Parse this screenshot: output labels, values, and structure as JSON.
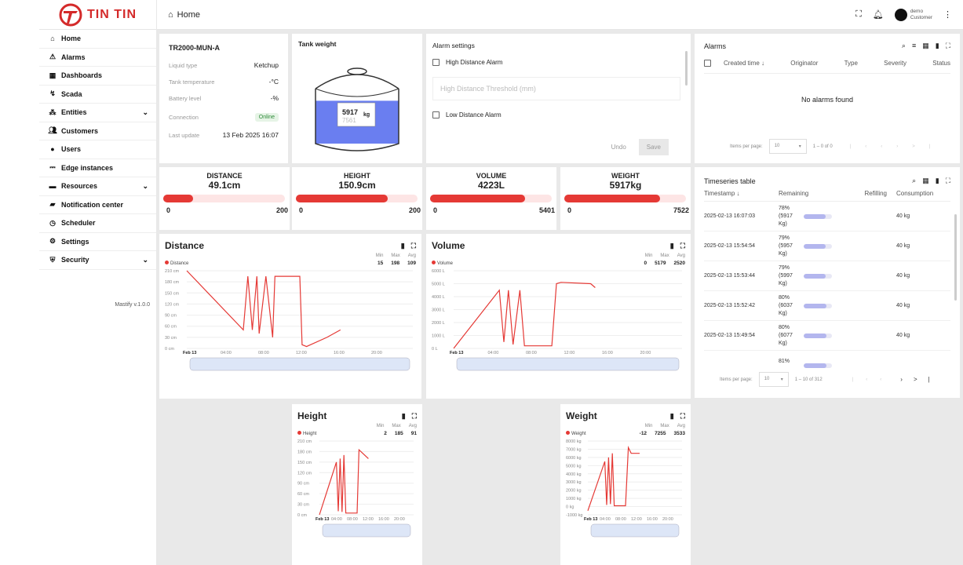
{
  "brand": {
    "name": "TIN TIN"
  },
  "nav": [
    {
      "label": "Home",
      "icon": "home-icon",
      "chev": ""
    },
    {
      "label": "Alarms",
      "icon": "warning-icon",
      "chev": ""
    },
    {
      "label": "Dashboards",
      "icon": "dashboard-icon",
      "chev": ""
    },
    {
      "label": "Scada",
      "icon": "scada-icon",
      "chev": ""
    },
    {
      "label": "Entities",
      "icon": "entities-icon",
      "chev": "⌄"
    },
    {
      "label": "Customers",
      "icon": "customers-icon",
      "chev": ""
    },
    {
      "label": "Users",
      "icon": "user-icon",
      "chev": ""
    },
    {
      "label": "Edge instances",
      "icon": "edge-icon",
      "chev": ""
    },
    {
      "label": "Resources",
      "icon": "folder-icon",
      "chev": "⌄"
    },
    {
      "label": "Notification center",
      "icon": "inbox-icon",
      "chev": ""
    },
    {
      "label": "Scheduler",
      "icon": "clock-icon",
      "chev": ""
    },
    {
      "label": "Settings",
      "icon": "gear-icon",
      "chev": ""
    },
    {
      "label": "Security",
      "icon": "shield-icon",
      "chev": "⌄"
    }
  ],
  "version": "Mastify v.1.0.0",
  "topbar": {
    "title": "Home",
    "user_name": "demo",
    "user_role": "Customer"
  },
  "device": {
    "name": "TR2000-MUN-A",
    "rows": [
      {
        "label": "Liquid type",
        "value": "Ketchup"
      },
      {
        "label": "Tank temperature",
        "value": "-°C"
      },
      {
        "label": "Battery level",
        "value": "-%"
      }
    ],
    "connection_label": "Connection",
    "connection_value": "Online",
    "update_label": "Last update",
    "update_value": "13 Feb 2025 16:07"
  },
  "tank": {
    "title": "Tank weight",
    "value": "5917",
    "capacity": "7561",
    "unit": "kg",
    "fill": 0.78
  },
  "alarm_settings": {
    "title": "Alarm settings",
    "high_label": "High Distance Alarm",
    "threshold_placeholder": "High Distance Threshold (mm)",
    "low_label": "Low Distance Alarm",
    "undo": "Undo",
    "save": "Save"
  },
  "alarms": {
    "title": "Alarms",
    "cols": [
      "Created time ↓",
      "Originator",
      "Type",
      "Severity",
      "Status"
    ],
    "empty": "No alarms found",
    "ipp_label": "Items per page:",
    "ipp": "10",
    "range": "1 – 0 of 0"
  },
  "gauges": [
    {
      "title": "DISTANCE",
      "value": "49.1cm",
      "min": "0",
      "max": "200",
      "fill": 0.245
    },
    {
      "title": "HEIGHT",
      "value": "150.9cm",
      "min": "0",
      "max": "200",
      "fill": 0.755
    },
    {
      "title": "VOLUME",
      "value": "4223L",
      "min": "0",
      "max": "5401",
      "fill": 0.782
    },
    {
      "title": "WEIGHT",
      "value": "5917kg",
      "min": "0",
      "max": "7522",
      "fill": 0.787
    }
  ],
  "stat_labels": {
    "min": "Min",
    "max": "Max",
    "avg": "Avg"
  },
  "charts": {
    "distance": {
      "title": "Distance",
      "legend": "Distance",
      "min": "15",
      "max": "198",
      "avg": "109",
      "yticks": [
        "210 cm",
        "180 cm",
        "150 cm",
        "120 cm",
        "90 cm",
        "60 cm",
        "30 cm",
        "0 cm"
      ],
      "xticks": [
        "Feb 13",
        "04:00",
        "08:00",
        "12:00",
        "16:00",
        "20:00"
      ]
    },
    "volume": {
      "title": "Volume",
      "legend": "Volume",
      "min": "0",
      "max": "5179",
      "avg": "2520",
      "yticks": [
        "6000 L",
        "5000 L",
        "4000 L",
        "3000 L",
        "2000 L",
        "1000 L",
        "0 L"
      ],
      "xticks": [
        "Feb 13",
        "04:00",
        "08:00",
        "12:00",
        "16:00",
        "20:00"
      ]
    },
    "height": {
      "title": "Height",
      "legend": "Height",
      "min": "2",
      "max": "185",
      "avg": "91",
      "yticks": [
        "210 cm",
        "180 cm",
        "150 cm",
        "120 cm",
        "90 cm",
        "60 cm",
        "30 cm",
        "0 cm"
      ],
      "xticks": [
        "Feb 13",
        "04:00",
        "08:00",
        "12:00",
        "16:00",
        "20:00"
      ]
    },
    "weight": {
      "title": "Weight",
      "legend": "Weight",
      "min": "-12",
      "max": "7255",
      "avg": "3533",
      "yticks": [
        "8000 kg",
        "7000 kg",
        "6000 kg",
        "5000 kg",
        "4000 kg",
        "3000 kg",
        "2000 kg",
        "1000 kg",
        "0 kg",
        "-1000 kg"
      ],
      "xticks": [
        "Feb 13",
        "04:00",
        "08:00",
        "12:00",
        "16:00",
        "20:00"
      ]
    }
  },
  "timeseries": {
    "title": "Timeseries table",
    "cols": [
      "Timestamp ↓",
      "Remaining",
      "Refilling",
      "Consumption"
    ],
    "rows": [
      {
        "ts": "2025-02-13 16:07:03",
        "pct": "78%",
        "kg": "(5917",
        "unit": "Kg)",
        "fill": 0.78,
        "consumption": "40 kg"
      },
      {
        "ts": "2025-02-13 15:54:54",
        "pct": "79%",
        "kg": "(5957",
        "unit": "Kg)",
        "fill": 0.79,
        "consumption": "40 kg"
      },
      {
        "ts": "2025-02-13 15:53:44",
        "pct": "79%",
        "kg": "(5997",
        "unit": "Kg)",
        "fill": 0.79,
        "consumption": "40 kg"
      },
      {
        "ts": "2025-02-13 15:52:42",
        "pct": "80%",
        "kg": "(6037",
        "unit": "Kg)",
        "fill": 0.8,
        "consumption": "40 kg"
      },
      {
        "ts": "2025-02-13 15:49:54",
        "pct": "80%",
        "kg": "(6077",
        "unit": "Kg)",
        "fill": 0.8,
        "consumption": "40 kg"
      },
      {
        "ts": "",
        "pct": "81%",
        "kg": "",
        "unit": "",
        "fill": 0.81,
        "consumption": ""
      }
    ],
    "ipp_label": "Items per page:",
    "ipp": "10",
    "range": "1 – 10 of 312"
  }
}
